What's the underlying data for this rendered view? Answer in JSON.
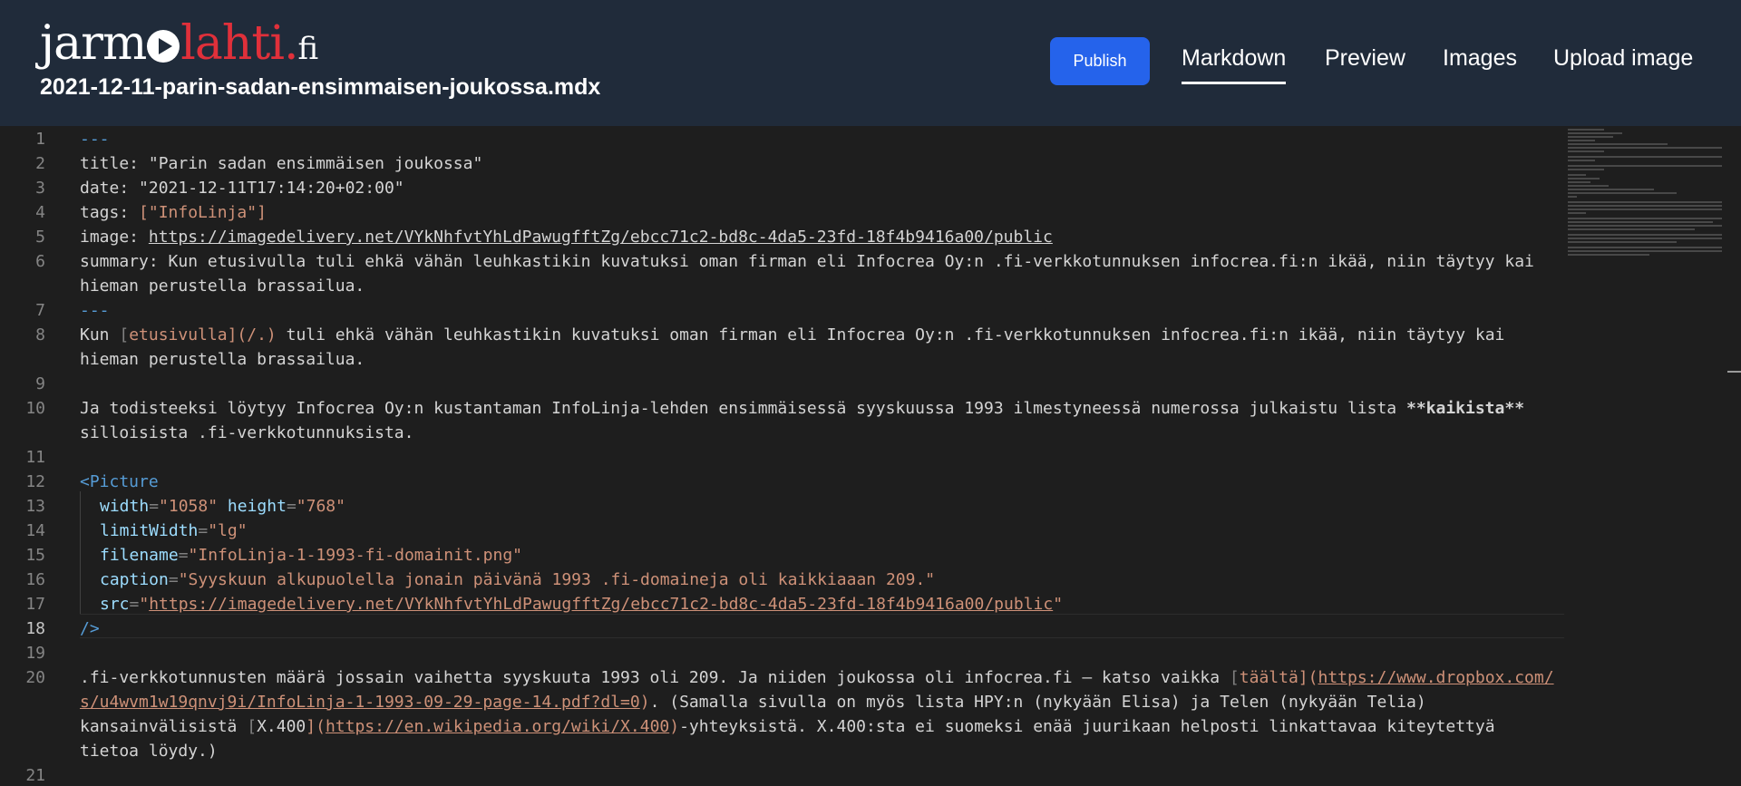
{
  "header": {
    "logo": {
      "part1": "jarm",
      "part2": "lahti",
      "dot": ".",
      "tld": "fi"
    },
    "filename": "2021-12-11-parin-sadan-ensimmaisen-joukossa.mdx",
    "publish_label": "Publish",
    "nav": [
      {
        "label": "Markdown",
        "active": true
      },
      {
        "label": "Preview",
        "active": false
      },
      {
        "label": "Images",
        "active": false
      },
      {
        "label": "Upload image",
        "active": false
      }
    ]
  },
  "editor": {
    "current_line": 18,
    "line_numbers": [
      "1",
      "2",
      "3",
      "4",
      "5",
      "6",
      "7",
      "8",
      "9",
      "10",
      "11",
      "12",
      "13",
      "14",
      "15",
      "16",
      "17",
      "18",
      "19",
      "20",
      "21"
    ],
    "rows": {
      "l1": "---",
      "l2": "title: \"Parin sadan ensimmäisen joukossa\"",
      "l3": "date: \"2021-12-11T17:14:20+02:00\"",
      "l4_key": "tags: ",
      "l4_val": "[\"InfoLinja\"]",
      "l5_key": "image: ",
      "l5_url": "https://imagedelivery.net/VYkNhfvtYhLdPawugfftZg/ebcc71c2-bd8c-4da5-23fd-18f4b9416a00/public",
      "l6a": "summary: Kun etusivulla tuli ehkä vähän leuhkastikin kuvatuksi oman firman eli Infocrea Oy:n .fi-verkkotunnuksen infocrea.fi:n ikää, niin täytyy kai",
      "l6b": "hieman perustella brassailua.",
      "l7": "---",
      "l8a_pre": "Kun ",
      "l8a_lb": "[",
      "l8a_text": "etusivulla",
      "l8a_rb": "](/.)",
      "l8a_post": " tuli ehkä vähän leuhkastikin kuvatuksi oman firman eli Infocrea Oy:n .fi-verkkotunnuksen infocrea.fi:n ikää, niin täytyy kai",
      "l8b": "hieman perustella brassailua.",
      "l10a_pre": "Ja todisteeksi löytyy Infocrea Oy:n kustantaman InfoLinja-lehden ensimmäisessä syyskuussa 1993 ilmestyneessä numerossa julkaistu lista ",
      "l10a_bold": "**kaikista**",
      "l10b": "silloisista .fi-verkkotunnuksista.",
      "l12_tag": "<Picture",
      "l13_a1": "width",
      "l13_v1": "\"1058\"",
      "l13_a2": "height",
      "l13_v2": "\"768\"",
      "l14_a": "limitWidth",
      "l14_v": "\"lg\"",
      "l15_a": "filename",
      "l15_v": "\"InfoLinja-1-1993-fi-domainit.png\"",
      "l16_a": "caption",
      "l16_v": "\"Syyskuun alkupuolella jonain päivänä 1993 .fi-domaineja oli kaikkiaaan 209.\"",
      "l17_a": "src",
      "l17_q": "\"",
      "l17_url": "https://imagedelivery.net/VYkNhfvtYhLdPawugfftZg/ebcc71c2-bd8c-4da5-23fd-18f4b9416a00/public",
      "l17_q2": "\"",
      "l18": "/>",
      "l20a_pre": ".fi-verkkotunnusten määrä jossain vaihetta syyskuuta 1993 oli 209. Ja niiden joukossa oli infocrea.fi – katso vaikka ",
      "l20a_lb": "[",
      "l20a_text": "täältä",
      "l20a_mid": "](",
      "l20a_url": "https://www.dropbox.com/",
      "l20b_url": "s/u4wvm1w19qnvj9i/InfoLinja-1-1993-09-29-page-14.pdf?dl=0",
      "l20b_close": ")",
      "l20b_post": ". (Samalla sivulla on myös lista HPY:n (nykyään Elisa) ja Telen (nykyään Telia)",
      "l20c_pre": "kansainvälisistä ",
      "l20c_lb": "[",
      "l20c_text": "X.400",
      "l20c_mid": "](",
      "l20c_url": "https://en.wikipedia.org/wiki/X.400",
      "l20c_close": ")",
      "l20c_post": "-yhteyksistä. X.400:sta ei suomeksi enää juurikaan helposti linkattavaa kiteytettyä",
      "l20d": "tietoa löydy.)"
    }
  }
}
